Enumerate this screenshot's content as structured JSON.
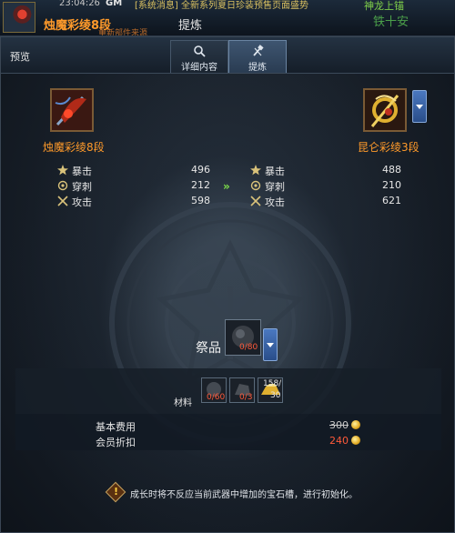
{
  "top_bar": {
    "time": "23:04:26",
    "gm": "GM",
    "news": "[系统消息] 全新系列夏日珍装预售页面盛势",
    "character_name": "烛魔彩绫8段",
    "sub_text": "重新部件来源",
    "title_behind": "提炼",
    "right_top": "神龙上锚",
    "right_bottom": "铁十安"
  },
  "window": {
    "title": "预览",
    "tabs": [
      {
        "label": "详细内容",
        "icon": "search-icon",
        "active": false
      },
      {
        "label": "提炼",
        "icon": "hammer-icon",
        "active": true
      }
    ]
  },
  "source_item": {
    "name": "烛魔彩绫8段",
    "icon": "crimson-weapon-icon",
    "stats": [
      {
        "icon": "crit-star-icon",
        "label": "暴击",
        "value": "496"
      },
      {
        "icon": "pierce-icon",
        "label": "穿刺",
        "value": "212"
      },
      {
        "icon": "crossed-swords-icon",
        "label": "攻击",
        "value": "598"
      }
    ]
  },
  "target_item": {
    "name": "昆仑彩绫3段",
    "icon": "golden-weapon-icon",
    "stats": [
      {
        "icon": "crit-star-icon",
        "label": "暴击",
        "value": "488"
      },
      {
        "icon": "pierce-icon",
        "label": "穿刺",
        "value": "210"
      },
      {
        "icon": "crossed-swords-icon",
        "label": "攻击",
        "value": "621"
      }
    ]
  },
  "offering": {
    "label": "祭品",
    "count": "0/80"
  },
  "materials": {
    "label": "材料",
    "items": [
      {
        "icon": "stone-icon",
        "count": "0/60"
      },
      {
        "icon": "ore-icon",
        "count": "0/3"
      },
      {
        "icon": "gold-ingot-icon",
        "count_top": "158/",
        "count_bottom": "30"
      }
    ]
  },
  "costs": {
    "base_label": "基本费用",
    "base_value": "300",
    "member_label": "会员折扣",
    "member_value": "240"
  },
  "notice": "成长时将不反应当前武器中增加的宝石槽，进行初始化。",
  "colors": {
    "item_name": "#ff9a2a",
    "discount": "#ff5a3a",
    "arrow": "#7ee04a",
    "accent_blue": "#4a78c0"
  }
}
